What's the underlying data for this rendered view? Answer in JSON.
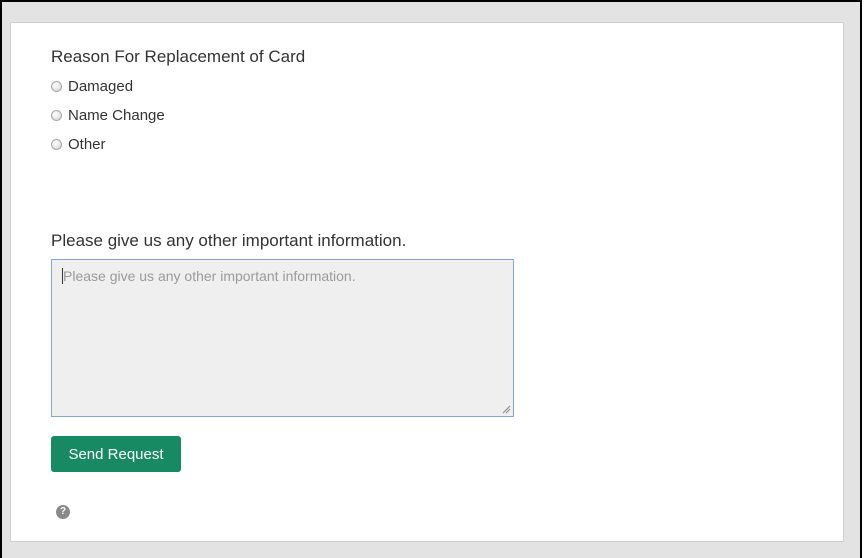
{
  "form": {
    "reason_title": "Reason For Replacement of Card",
    "reason_options": [
      {
        "label": "Damaged",
        "selected": false
      },
      {
        "label": "Name Change",
        "selected": false
      },
      {
        "label": "Other",
        "selected": false
      }
    ],
    "info_label": "Please give us any other important information.",
    "info_placeholder": "Please give us any other important information.",
    "info_value": "",
    "submit_label": "Send Request",
    "help_icon": "question-circle-icon"
  },
  "colors": {
    "button": "#178a63",
    "textarea_focus_border": "#7fa7e8",
    "page_background": "#e3e3e3"
  }
}
